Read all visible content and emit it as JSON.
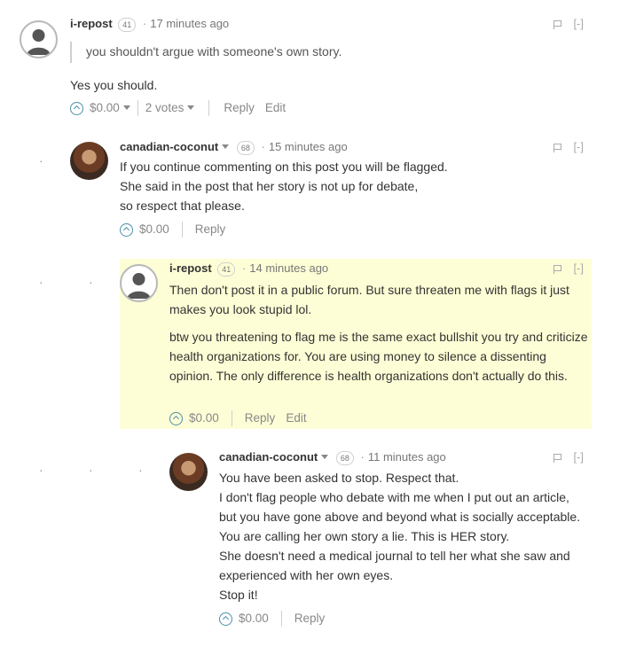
{
  "comments": [
    {
      "author": "i-repost",
      "reputation": "41",
      "time": "17 minutes ago",
      "collapse": "[-]",
      "quote": "you shouldn't argue with someone's own story.",
      "body": [
        "Yes you should."
      ],
      "payout": "$0.00",
      "votes": "2 votes",
      "actions": [
        "Reply",
        "Edit"
      ]
    },
    {
      "author": "canadian-coconut",
      "reputation": "68",
      "time": "15 minutes ago",
      "collapse": "[-]",
      "body": [
        "If you continue commenting on this post you will be flagged.",
        "She said in the post that her story is not up for debate,",
        "so respect that please."
      ],
      "payout": "$0.00",
      "actions": [
        "Reply"
      ]
    },
    {
      "author": "i-repost",
      "reputation": "41",
      "time": "14 minutes ago",
      "collapse": "[-]",
      "paragraphs": [
        "Then don't post it in a public forum. But sure threaten me with flags it just makes you look stupid lol.",
        "btw you threatening to flag me is the same exact bullshit you try and criticize health organizations for. You are using money to silence a dissenting opinion. The only difference is health organizations don't actually do this."
      ],
      "payout": "$0.00",
      "actions": [
        "Reply",
        "Edit"
      ]
    },
    {
      "author": "canadian-coconut",
      "reputation": "68",
      "time": "11 minutes ago",
      "collapse": "[-]",
      "body": [
        "You have been asked to stop. Respect that.",
        "I don't flag people who debate with me when I put out an article,",
        "but you have gone above and beyond what is socially acceptable.",
        "You are calling her own story a lie. This is HER story.",
        "She doesn't need a medical journal to tell her what she saw and",
        "experienced with her own eyes.",
        "Stop it!"
      ],
      "payout": "$0.00",
      "actions": [
        "Reply"
      ]
    }
  ],
  "separator": "·",
  "colors": {
    "highlight": "#fefed6",
    "upvote": "#4a8fa9"
  },
  "icons": {
    "avatar_default": "user-silhouette-icon",
    "flag": "flag-icon",
    "upvote": "upvote-circle-icon",
    "dropdown": "caret-down-icon"
  }
}
